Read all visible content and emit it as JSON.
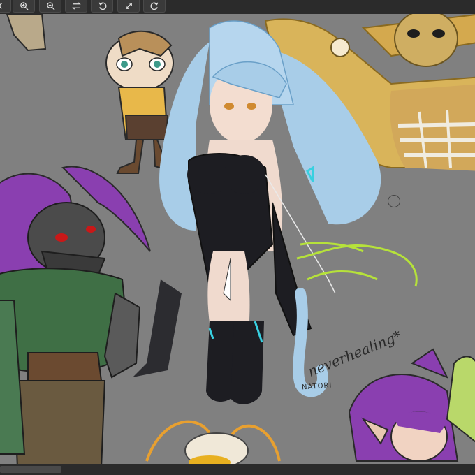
{
  "toolbar": {
    "buttons": [
      {
        "icon": "chevron-left-icon"
      },
      {
        "icon": "zoom-in-icon"
      },
      {
        "icon": "zoom-out-icon"
      },
      {
        "icon": "flip-horizontal-icon"
      },
      {
        "icon": "rotate-left-icon"
      },
      {
        "icon": "fullscreen-icon"
      },
      {
        "icon": "rotate-right-icon"
      }
    ]
  },
  "canvas": {
    "signature_text": "NATORI",
    "handwriting_text": "neverhealing*"
  },
  "colors": {
    "toolbar_bg": "#2b2b2b",
    "canvas_bg": "#808080",
    "hair_blue": "#a8cde8",
    "purple_hair": "#8a3fb0",
    "lime_scribble": "#b6e23a",
    "moth_gold": "#d9b45a"
  }
}
